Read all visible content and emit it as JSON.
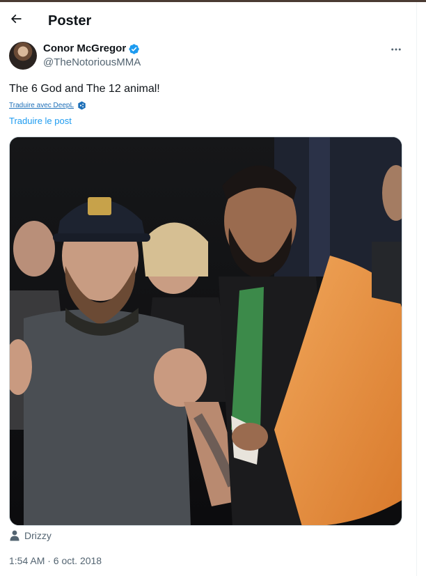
{
  "header": {
    "back_icon": "arrow-left-icon",
    "title": "Poster"
  },
  "post": {
    "author": {
      "name": "Conor McGregor",
      "handle": "@TheNotoriousMMA",
      "verified": true,
      "verified_color": "#1d9bf0"
    },
    "text": "The 6 God and The 12 animal!",
    "translate_deepl_label": "Traduire avec DeepL",
    "translate_post_label": "Traduire le post",
    "tagged_user": "Drizzy",
    "timestamp": "1:54 AM · 6 oct. 2018"
  },
  "colors": {
    "text_primary": "#0f1419",
    "text_secondary": "#536471",
    "link": "#1d9bf0"
  }
}
